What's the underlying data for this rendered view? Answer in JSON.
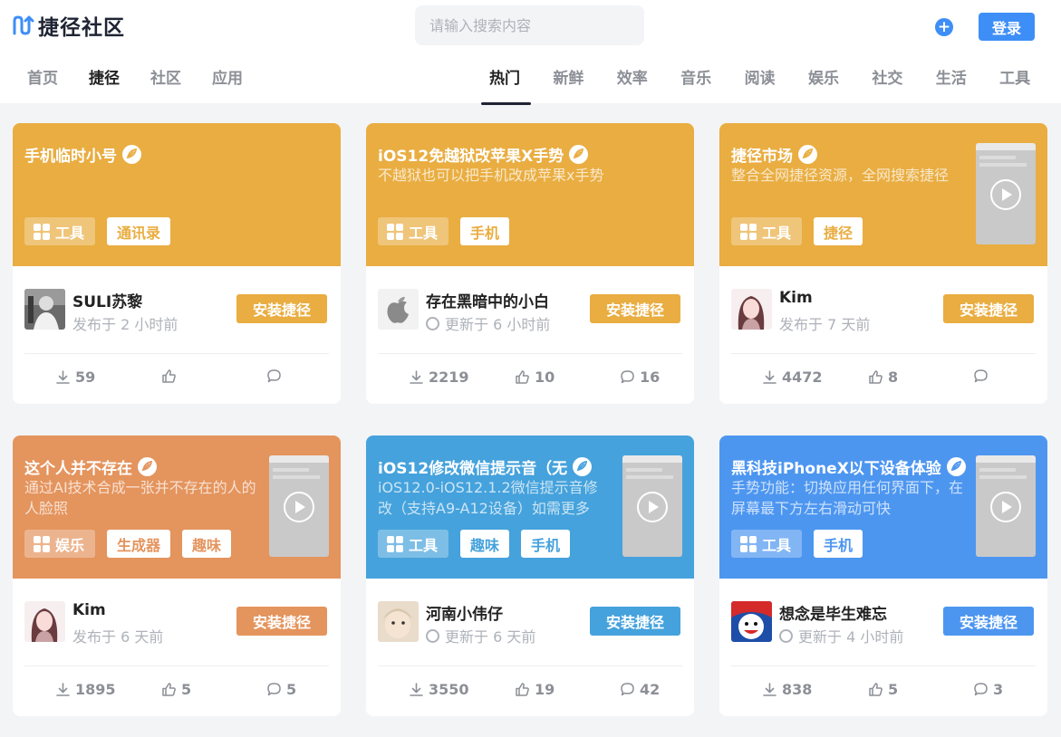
{
  "header": {
    "logo_text": "捷径社区",
    "search_placeholder": "请输入搜索内容",
    "add_label": "+",
    "login_label": "登录"
  },
  "nav_left": [
    {
      "label": "首页",
      "active": false
    },
    {
      "label": "捷径",
      "active": true
    },
    {
      "label": "社区",
      "active": false
    },
    {
      "label": "应用",
      "active": false
    }
  ],
  "nav_right": [
    {
      "label": "热门",
      "active": true
    },
    {
      "label": "新鲜",
      "active": false
    },
    {
      "label": "效率",
      "active": false
    },
    {
      "label": "音乐",
      "active": false
    },
    {
      "label": "阅读",
      "active": false
    },
    {
      "label": "娱乐",
      "active": false
    },
    {
      "label": "社交",
      "active": false
    },
    {
      "label": "生活",
      "active": false
    },
    {
      "label": "工具",
      "active": false
    }
  ],
  "colors": {
    "accent_blue": "#3e8ef7",
    "yellow": "#e9ad41",
    "orange": "#e4945d",
    "sky": "#45a2dc",
    "blue": "#4d96f0"
  },
  "cards": [
    {
      "title": "手机临时小号",
      "desc": "",
      "color": "#e9ad41",
      "has_thumb": false,
      "tags": [
        {
          "label": "工具",
          "kind": "cat"
        },
        {
          "label": "通讯录",
          "kind": "plain"
        }
      ],
      "author": "SULI苏黎",
      "time": "发布于 2 小时前",
      "time_kind": "published",
      "avatar": "avatar-suli",
      "install_label": "安装捷径",
      "downloads": "59",
      "likes": "",
      "comments": ""
    },
    {
      "title": "iOS12免越狱改苹果X手势",
      "desc": "不越狱也可以把手机改成苹果x手势",
      "color": "#e9ad41",
      "has_thumb": false,
      "tags": [
        {
          "label": "工具",
          "kind": "cat"
        },
        {
          "label": "手机",
          "kind": "plain"
        }
      ],
      "author": "存在黑暗中的小白",
      "time": "更新于 6 小时前",
      "time_kind": "updated",
      "avatar": "avatar-apple",
      "install_label": "安装捷径",
      "downloads": "2219",
      "likes": "10",
      "comments": "16"
    },
    {
      "title": "捷径市场",
      "desc": "整合全网捷径资源，全网搜索捷径",
      "color": "#e9ad41",
      "has_thumb": true,
      "tags": [
        {
          "label": "工具",
          "kind": "cat"
        },
        {
          "label": "捷径",
          "kind": "plain"
        }
      ],
      "author": "Kim",
      "time": "发布于 7 天前",
      "time_kind": "published",
      "avatar": "avatar-kim",
      "install_label": "安装捷径",
      "downloads": "4472",
      "likes": "8",
      "comments": ""
    },
    {
      "title": "这个人并不存在",
      "desc": "通过AI技术合成一张并不存在的人的人脸照",
      "color": "#e4945d",
      "has_thumb": true,
      "tags": [
        {
          "label": "娱乐",
          "kind": "cat"
        },
        {
          "label": "生成器",
          "kind": "plain"
        },
        {
          "label": "趣味",
          "kind": "plain"
        }
      ],
      "author": "Kim",
      "time": "发布于 6 天前",
      "time_kind": "published",
      "avatar": "avatar-kim",
      "install_label": "安装捷径",
      "downloads": "1895",
      "likes": "5",
      "comments": "5"
    },
    {
      "title": "iOS12修改微信提示音（无",
      "desc": "iOS12.0-iOS12.1.2微信提示音修改（支持A9-A12设备）如需更多",
      "color": "#45a2dc",
      "has_thumb": true,
      "tags": [
        {
          "label": "工具",
          "kind": "cat"
        },
        {
          "label": "趣味",
          "kind": "plain"
        },
        {
          "label": "手机",
          "kind": "plain"
        }
      ],
      "author": "河南小伟仔",
      "time": "更新于 6 天前",
      "time_kind": "updated",
      "avatar": "avatar-baby",
      "install_label": "安装捷径",
      "downloads": "3550",
      "likes": "19",
      "comments": "42"
    },
    {
      "title": "黑科技iPhoneX以下设备体验",
      "desc": "手势功能：切换应用任何界面下，在屏幕最下方左右滑动可快",
      "color": "#4d96f0",
      "has_thumb": true,
      "tags": [
        {
          "label": "工具",
          "kind": "cat"
        },
        {
          "label": "手机",
          "kind": "plain"
        }
      ],
      "author": "想念是毕生难忘",
      "time": "更新于 4 小时前",
      "time_kind": "updated",
      "avatar": "avatar-cartoon",
      "install_label": "安装捷径",
      "downloads": "838",
      "likes": "5",
      "comments": "3"
    }
  ]
}
